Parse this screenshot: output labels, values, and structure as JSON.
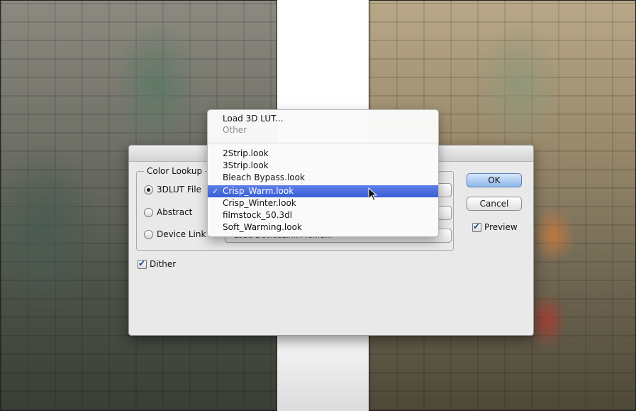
{
  "dialog": {
    "title": "Color Lookup",
    "group_label": "Color Lookup",
    "options": [
      {
        "label": "3DLUT File",
        "selected": true,
        "popup_value": ""
      },
      {
        "label": "Abstract",
        "selected": false,
        "popup_value": ""
      },
      {
        "label": "Device Link",
        "selected": false,
        "popup_value": "Load DeviceLink Profile..."
      }
    ],
    "dither": {
      "label": "Dither",
      "checked": true
    },
    "buttons": {
      "ok": "OK",
      "cancel": "Cancel"
    },
    "preview": {
      "label": "Preview",
      "checked": true
    }
  },
  "menu": {
    "load_label": "Load 3D LUT...",
    "other_label": "Other",
    "items": [
      {
        "label": "2Strip.look",
        "selected": false
      },
      {
        "label": "3Strip.look",
        "selected": false
      },
      {
        "label": "Bleach Bypass.look",
        "selected": false
      },
      {
        "label": "Crisp_Warm.look",
        "selected": true
      },
      {
        "label": "Crisp_Winter.look",
        "selected": false
      },
      {
        "label": "filmstock_50.3dl",
        "selected": false
      },
      {
        "label": "Soft_Warming.look",
        "selected": false
      }
    ],
    "check_glyph": "✓"
  }
}
